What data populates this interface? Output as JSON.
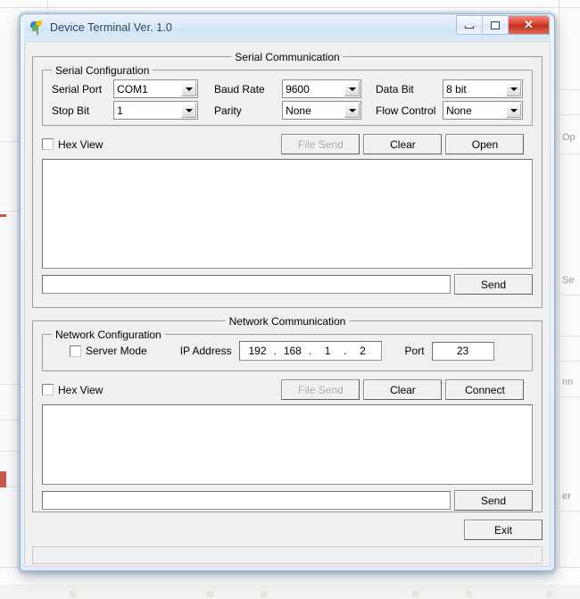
{
  "window": {
    "title": "Device Terminal Ver. 1.0",
    "icon": "app-leaf-icon",
    "controls": {
      "minimize": "minimize-icon",
      "maximize": "maximize-icon",
      "close": "✕"
    }
  },
  "serial_section": {
    "title": "Serial Communication",
    "config": {
      "title": "Serial Configuration",
      "fields": [
        {
          "label": "Serial Port",
          "value": "COM1"
        },
        {
          "label": "Baud Rate",
          "value": "9600"
        },
        {
          "label": "Data Bit",
          "value": "8 bit"
        },
        {
          "label": "Stop Bit",
          "value": "1"
        },
        {
          "label": "Parity",
          "value": "None"
        },
        {
          "label": "Flow Control",
          "value": "None"
        }
      ]
    },
    "hex_view_label": "Hex View",
    "hex_view_checked": false,
    "buttons": {
      "file_send": "File Send",
      "file_send_enabled": false,
      "clear": "Clear",
      "open": "Open"
    },
    "log_text": "",
    "input_value": "",
    "send_label": "Send"
  },
  "network_section": {
    "title": "Network Communication",
    "config": {
      "title": "Network Configuration",
      "server_mode_label": "Server Mode",
      "server_mode_checked": false,
      "ip_label": "IP Address",
      "ip_octets": [
        "192",
        "168",
        "1",
        "2"
      ],
      "ip_separator": ".",
      "port_label": "Port",
      "port_value": "23"
    },
    "hex_view_label": "Hex View",
    "hex_view_checked": false,
    "buttons": {
      "file_send": "File Send",
      "file_send_enabled": false,
      "clear": "Clear",
      "connect": "Connect"
    },
    "log_text": "",
    "input_value": "",
    "send_label": "Send"
  },
  "footer": {
    "exit_label": "Exit",
    "status_text": ""
  },
  "background": {
    "fragments": [
      "Op",
      "Se",
      "nn",
      "er"
    ]
  },
  "colors": {
    "dialog_face": "#f0f0f0",
    "title_bar": "#dbebfa",
    "close_button": "#d9412c",
    "frame_border": "#8aaed4",
    "group_border": "#a0a0a0",
    "text": "#000000",
    "disabled_text": "#a6a6a6"
  }
}
